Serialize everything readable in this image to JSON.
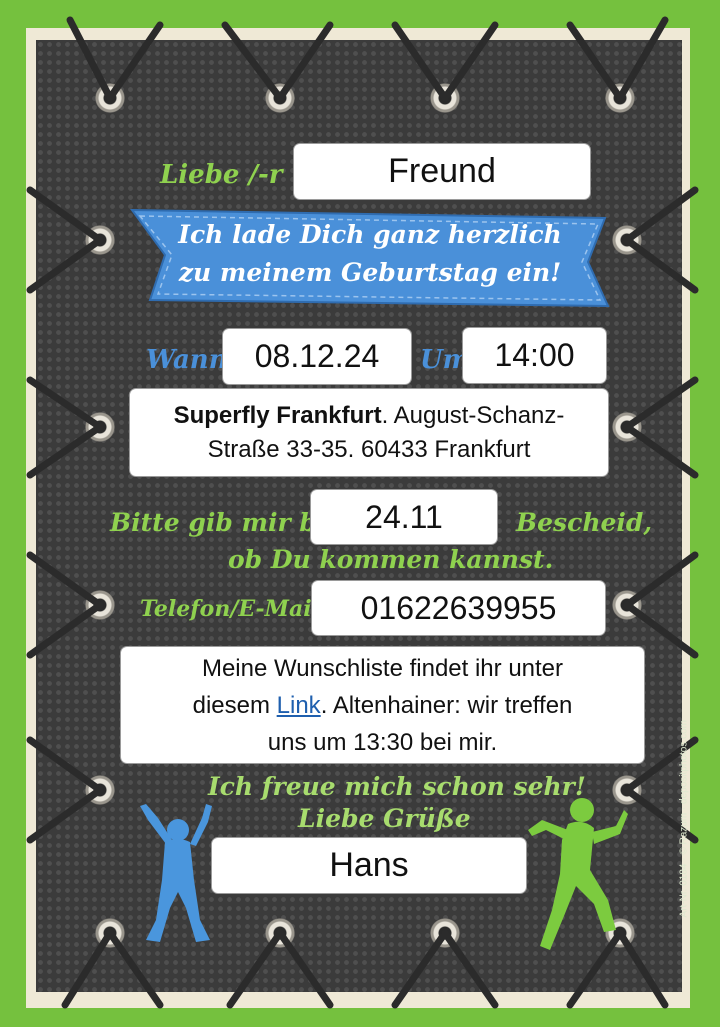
{
  "greeting": {
    "label": "Liebe /-r",
    "name": "Freund"
  },
  "banner": {
    "line1": "Ich lade Dich ganz herzlich",
    "line2": "zu meinem Geburtstag ein!"
  },
  "when": {
    "label": "Wann",
    "date": "08.12.24",
    "time_label": "Um",
    "time": "14:00"
  },
  "location": {
    "venue": "Superfly Frankfurt",
    "address_line1": ". August-Schanz-",
    "address_line2": "Straße 33-35. 60433 Frankfurt"
  },
  "rsvp": {
    "line1_before": "Bitte gib mir bis",
    "deadline": "24.11",
    "line1_after": "Bescheid,",
    "line2": "ob Du kommen kannst."
  },
  "contact": {
    "label": "Telefon/E-Mail",
    "value": "01622639955"
  },
  "wishlist": {
    "text_before": "Meine Wunschliste findet ihr unter",
    "text_diesem": "diesem ",
    "link_label": "Link",
    "text_after": ". Altenhainer: wir treffen",
    "line3": "uns um 13:30 bei mir."
  },
  "closing": {
    "line1": "Ich freue mich schon sehr!",
    "line2": "Liebe Grüße",
    "signature": "Hans"
  },
  "credit": "Art-Nr. 0184 · © Razum · depositphotos.com",
  "colors": {
    "green": "#75c13e",
    "blue_banner": "#4a90d9",
    "board": "#3b3b3b",
    "script_green": "#8fd14f"
  }
}
